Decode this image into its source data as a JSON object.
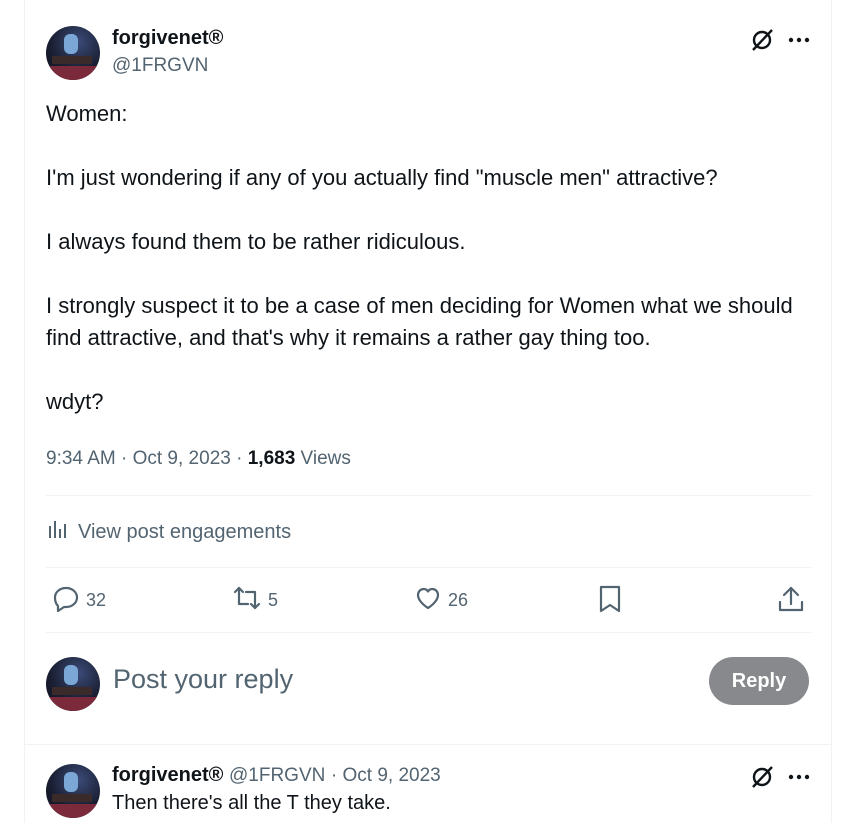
{
  "post": {
    "author_name": "forgivenet®",
    "author_handle": "@1FRGVN",
    "paragraphs": [
      "Women:",
      "I'm just wondering if any of you actually find \"muscle men\" attractive?",
      "I always found them to be rather ridiculous.",
      "I strongly suspect it to be a case of men deciding for Women what we should find attractive, and that's why it remains a rather gay thing too.",
      "wdyt?"
    ],
    "time": "9:34 AM · Oct 9, 2023 · ",
    "views_count": "1,683",
    "views_label": " Views",
    "engagements_label": "View post engagements",
    "actions": {
      "replies": "32",
      "reposts": "5",
      "likes": "26"
    }
  },
  "composer": {
    "placeholder": "Post your reply",
    "button_label": "Reply"
  },
  "reply": {
    "author_name": "forgivenet®",
    "author_handle": "@1FRGVN",
    "date": "· Oct 9, 2023",
    "text": "Then there's all the T they take."
  },
  "colors": {
    "text_primary": "#0f1419",
    "text_secondary": "#536471",
    "reply_button_bg": "#87898c",
    "divider": "#eff3f4"
  }
}
